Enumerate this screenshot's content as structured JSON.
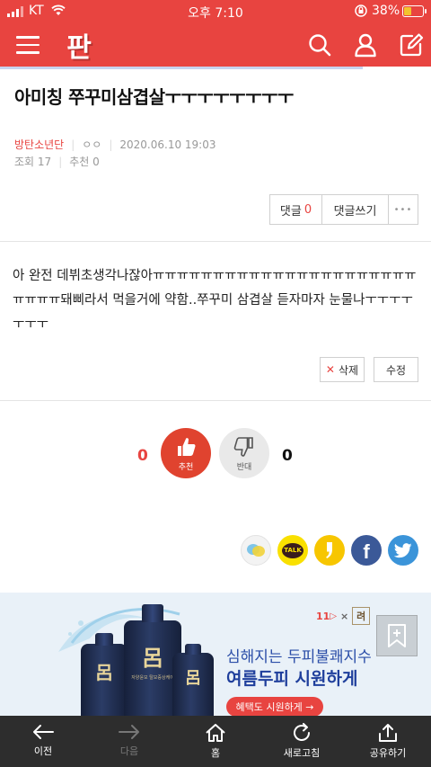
{
  "status_bar": {
    "carrier": "KT",
    "time": "오후 7:10",
    "battery": "38%",
    "battery_level": 0.38
  },
  "header": {
    "logo": "판"
  },
  "post": {
    "title": "아미칭 쭈꾸미삼겹살ㅜㅜㅜㅜㅜㅜㅜㅜ",
    "author": "방탄소년단",
    "author_badge": "ㅇㅇ",
    "datetime": "2020.06.10 19:03",
    "views_label": "조회",
    "views": "17",
    "recommend_label": "추천",
    "recommend": "0",
    "body": "아 완전 데뷔초생각나잖아ㅠㅠㅠㅠㅠㅠㅠㅠㅠㅠㅠㅠㅠㅠㅠㅠㅠㅠㅠㅠㅠㅠㅠㅠㅠㅠ돼삐라서 먹을거에 약함..쭈꾸미 삼겹살 듣자마자 눈물나ㅜㅜㅜㅜㅜㅜㅜ"
  },
  "comments": {
    "label": "댓글",
    "count": "0",
    "write_label": "댓글쓰기",
    "more_label": "•••"
  },
  "actions": {
    "delete_label": "삭제",
    "edit_label": "수정"
  },
  "votes": {
    "up_count": "0",
    "up_label": "추천",
    "down_label": "반대",
    "down_count": "0"
  },
  "share": {
    "kakao_label": "TALK"
  },
  "ad": {
    "brand_left": "11",
    "brand_right": "려",
    "line1": "심해지는 두피불쾌지수",
    "line2": "여름두피 시원하게",
    "cta": "혜택도 시원하게 →",
    "bottle_label": "呂",
    "bottle_small_text": "자양윤모 탈모증상케어"
  },
  "toolbar": {
    "back": "이전",
    "forward": "다음",
    "home": "홈",
    "refresh": "새로고침",
    "share": "공유하기"
  },
  "colors": {
    "brand_red": "#e84440",
    "toolbar_bg": "#2d2d2d"
  }
}
